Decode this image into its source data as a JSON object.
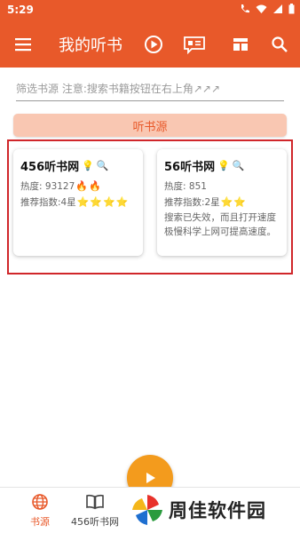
{
  "status_bar": {
    "time": "5:29"
  },
  "app_bar": {
    "title": "我的听书"
  },
  "filter": {
    "placeholder": "筛选书源 注意:搜索书籍按钮在右上角↗↗↗",
    "value": ""
  },
  "section": {
    "label": "听书源"
  },
  "sources": [
    {
      "name": "456听书网",
      "heat_label": "热度:",
      "heat_value": "93127",
      "rating_text": "推荐指数:4星",
      "stars": 4,
      "flames": 2,
      "description": ""
    },
    {
      "name": "56听书网",
      "heat_label": "热度:",
      "heat_value": "851",
      "rating_text": "推荐指数:2星",
      "stars": 2,
      "flames": 0,
      "description": "搜索已失效，而且打开速度极慢科学上网可提高速度。"
    }
  ],
  "bottom_nav": [
    {
      "label": "书源",
      "icon": "globe-icon",
      "active": true
    },
    {
      "label": "456听书网",
      "icon": "book-icon",
      "active": false
    }
  ],
  "watermark": {
    "text": "周佳软件园"
  },
  "colors": {
    "primary": "#e8592a",
    "section_bg": "#f9c7b2",
    "fab": "#f39b1d",
    "highlight": "#d0262a"
  }
}
